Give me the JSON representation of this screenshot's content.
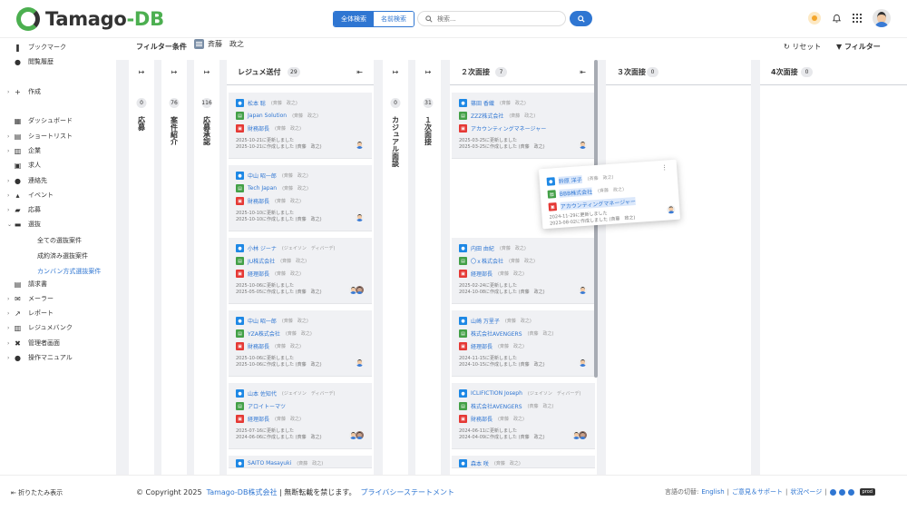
{
  "header": {
    "logo_a": "Tamago",
    "logo_b": "-DB",
    "seg_on": "全体検索",
    "seg_off": "名前検索",
    "search_placeholder": "検索..."
  },
  "sidebar": {
    "items": [
      {
        "label": "ブックマーク",
        "icon": "bookmark-icon"
      },
      {
        "label": "閲覧履歴",
        "icon": "history-icon"
      },
      {
        "label": "作成",
        "icon": "plus-icon"
      },
      {
        "label": "ダッシュボード",
        "icon": "dashboard-icon"
      },
      {
        "label": "ショートリスト",
        "icon": "list-icon"
      },
      {
        "label": "企業",
        "icon": "building-icon"
      },
      {
        "label": "求人",
        "icon": "briefcase-icon"
      },
      {
        "label": "連絡先",
        "icon": "user-icon"
      },
      {
        "label": "イベント",
        "icon": "event-icon"
      },
      {
        "label": "応募",
        "icon": "apply-icon"
      },
      {
        "label": "選抜",
        "icon": "selection-icon"
      },
      {
        "label": "請求書",
        "icon": "invoice-icon"
      },
      {
        "label": "メーラー",
        "icon": "mail-icon"
      },
      {
        "label": "レポート",
        "icon": "report-icon"
      },
      {
        "label": "レジュメバンク",
        "icon": "resume-icon"
      },
      {
        "label": "管理者画面",
        "icon": "tools-icon"
      },
      {
        "label": "操作マニュアル",
        "icon": "info-icon"
      }
    ],
    "sub": [
      "全ての選抜案件",
      "成約済み選抜案件",
      "カンバン方式選抜案件"
    ],
    "collapse": "折りたたみ表示"
  },
  "filter": {
    "label": "フィルター条件",
    "chip": "斉藤　政之",
    "reset": "リセット",
    "filter": "フィルター"
  },
  "columns": {
    "c1": {
      "count": "0",
      "title": "応募"
    },
    "c2": {
      "count": "76",
      "title": "案件紹介"
    },
    "c3": {
      "count": "116",
      "title": "応募承認"
    },
    "resume": {
      "title": "レジュメ送付",
      "count": "29"
    },
    "c5": {
      "count": "0",
      "title": "カジュアル面談"
    },
    "c6": {
      "count": "31",
      "title": "１次面接"
    },
    "second": {
      "title": "２次面接",
      "count": "7"
    },
    "third": {
      "title": "３次面接",
      "count": "0"
    },
    "fourth": {
      "title": "4次面接",
      "count": "0"
    }
  },
  "cards_resume": [
    {
      "name": "松本 聡",
      "tag": "(斉藤　政之)",
      "company": "Japan Solution",
      "ctag": "(斉藤　政之)",
      "job": "財務部長",
      "jtag": "(斉藤　政之)",
      "u": "2025-10-21に更新しました",
      "c": "2025-10-21に作成しました (斉藤　政之)"
    },
    {
      "name": "中山 昭一郎",
      "tag": "(斉藤　政之)",
      "company": "Tech Japan",
      "ctag": "(斉藤　政之)",
      "job": "財務部長",
      "jtag": "(斉藤　政之)",
      "u": "2025-10-10に更新しました",
      "c": "2025-10-10に作成しました (斉藤　政之)"
    },
    {
      "name": "小林 ジーナ",
      "tag": "(ジェイソン　ディバーデ)",
      "company": "JU株式会社",
      "ctag": "(斉藤　政之)",
      "job": "経理部長",
      "jtag": "(斉藤　政之)",
      "u": "2025-10-06に更新しました",
      "c": "2025-05-05に作成しました (斉藤　政之)"
    },
    {
      "name": "中山 昭一郎",
      "tag": "(斉藤　政之)",
      "company": "YZA株式会社",
      "ctag": "(斉藤　政之)",
      "job": "財務部長",
      "jtag": "(斉藤　政之)",
      "u": "2025-10-06に更新しました",
      "c": "2025-10-06に作成しました (斉藤　政之)"
    },
    {
      "name": "山本 佐知代",
      "tag": "(ジェイソン　ディバーデ)",
      "company": "アロイトーマツ",
      "ctag": "",
      "job": "経理部長",
      "jtag": "(斉藤　政之)",
      "u": "2025-07-16に更新しました",
      "c": "2024-06-06に作成しました (斉藤　政之)"
    },
    {
      "name": "SAITO Masayuki",
      "tag": "(斉藤　政之)"
    }
  ],
  "cards_second": [
    {
      "name": "篠田 香織",
      "tag": "(斉藤　政之)",
      "company": "ZZZ株式会社",
      "ctag": "(斉藤　政之)",
      "job": "アカウンティングマネージャー",
      "jtag": "",
      "u": "2025-03-25に更新しました",
      "c": "2025-03-25に作成しました (斉藤　政之)"
    },
    {
      "name": "内田 由紀",
      "tag": "(斉藤　政之)",
      "company": "〇ｘ株式会社",
      "ctag": "(斉藤　政之)",
      "job": "経理部長",
      "jtag": "(斉藤　政之)",
      "u": "2025-02-24に更新しました",
      "c": "2024-10-08に作成しました (斉藤　政之)"
    },
    {
      "name": "山崎 万里子",
      "tag": "(斉藤　政之)",
      "company": "株式会社AVENGERS",
      "ctag": "(斉藤　政之)",
      "job": "経理部長",
      "jtag": "(斉藤　政之)",
      "u": "2024-11-15に更新しました",
      "c": "2024-10-15に作成しました (斉藤　政之)"
    },
    {
      "name": "ICLIFICTION Joseph",
      "tag": "(ジェイソン　ディバーデ)",
      "company": "株式会社AVENGERS",
      "ctag": "(斉藤　政之)",
      "job": "財務部長",
      "jtag": "(斉藤　政之)",
      "u": "2024-06-11に更新しました",
      "c": "2024-04-09に作成しました (斉藤　政之)"
    },
    {
      "name": "森本 咲",
      "tag": "(斉藤　政之)"
    }
  ],
  "dragging": {
    "name": "鈴原 洋子",
    "tag": "(斉藤　政之)",
    "company": "BBB株式会社",
    "ctag": "(斉藤　政之)",
    "job": "アカウンティングマネージャー",
    "u": "2024-11-29に更新しました",
    "c": "2023-08-02に作成しました (斉藤　政之)"
  },
  "footer": {
    "copy": "© Copyright 2025",
    "company": "Tamago-DB株式会社",
    "rights": "| 無断転載を禁じます。",
    "privacy": "プライバシーステートメント",
    "lang_label": "言語の切替:",
    "lang": "English",
    "sep1": "|",
    "feedback": "ご意見＆サポート",
    "sep2": "|",
    "status": "状況ページ",
    "sep3": "|",
    "env": "prod"
  }
}
